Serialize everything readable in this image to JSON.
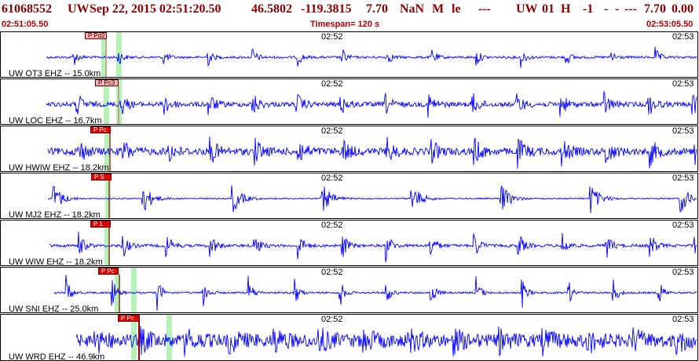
{
  "header": {
    "event_id": "61068552",
    "network": "UW",
    "datetime": "Sep 22, 2015 02:51:20.50",
    "lat": "46.5802",
    "lon": "-119.3815",
    "depth": "7.70",
    "mag": "NaN",
    "mag_type": "M",
    "type": "le",
    "dashes1": "---",
    "auth": "UW",
    "version": "01",
    "flag": "H",
    "minus_one": "-1",
    "dash_a": "-",
    "dash_b": "-",
    "dash_c": "---",
    "value_a": "7.70",
    "value_b": "0.00"
  },
  "timebar": {
    "start_time": "02:51:05.50",
    "timespan": "Timespan= 120 s",
    "end_time": "02:53:05.50"
  },
  "colors": {
    "trace": "#0000ff",
    "header_text": "#8b0000",
    "phase_marker": "#e00000",
    "window_band": "#b6f2b6"
  },
  "panels": [
    {
      "label": "UW OT3 EHZ -- 15.0km",
      "phase": "P Pd2",
      "tick_mid": "02:52",
      "tick_end": "02:53"
    },
    {
      "label": "UW LOC EHZ -- 16.7km",
      "phase": "P Pc3",
      "tick_mid": "02:52",
      "tick_end": "02:53"
    },
    {
      "label": "UW HWIW EHZ -- 18.2km",
      "phase": "P Pc",
      "tick_mid": "02:52",
      "tick_end": "02:53"
    },
    {
      "label": "UW MJ2 EHZ -- 18.2km",
      "phase": "P S",
      "tick_mid": "02:52",
      "tick_end": "02:53"
    },
    {
      "label": "UW WIW EHZ -- 18.2km",
      "phase": "P 1",
      "tick_mid": "02:52",
      "tick_end": "02:53"
    },
    {
      "label": "UW SNI EHZ -- 25.0km",
      "phase": "P Pc",
      "tick_mid": "02:52",
      "tick_end": "02:53"
    },
    {
      "label": "UW WRD EHZ -- 46.9km",
      "phase": "P Pc",
      "tick_mid": "02:52",
      "tick_end": "02:53"
    }
  ]
}
